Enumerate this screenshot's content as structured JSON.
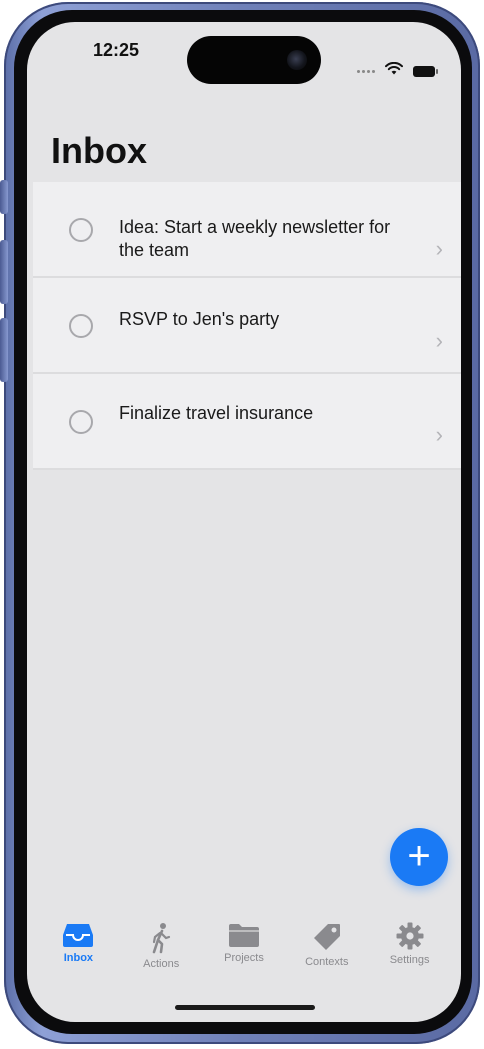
{
  "status_bar": {
    "time": "12:25"
  },
  "page": {
    "title": "Inbox"
  },
  "tasks": [
    {
      "text": "Idea: Start a weekly newsletter for the team"
    },
    {
      "text": "RSVP to Jen's party"
    },
    {
      "text": "Finalize travel insurance"
    }
  ],
  "fab": {
    "label": "+"
  },
  "tabs": [
    {
      "label": "Inbox",
      "icon": "inbox-tray-icon",
      "active": true
    },
    {
      "label": "Actions",
      "icon": "walking-person-icon",
      "active": false
    },
    {
      "label": "Projects",
      "icon": "folder-icon",
      "active": false
    },
    {
      "label": "Contexts",
      "icon": "tag-icon",
      "active": false
    },
    {
      "label": "Settings",
      "icon": "gear-icon",
      "active": false
    }
  ],
  "colors": {
    "accent": "#1a7af5",
    "screen_bg": "#e4e4e6",
    "row_bg": "#efeff1",
    "tab_inactive": "#8a8a8e"
  }
}
